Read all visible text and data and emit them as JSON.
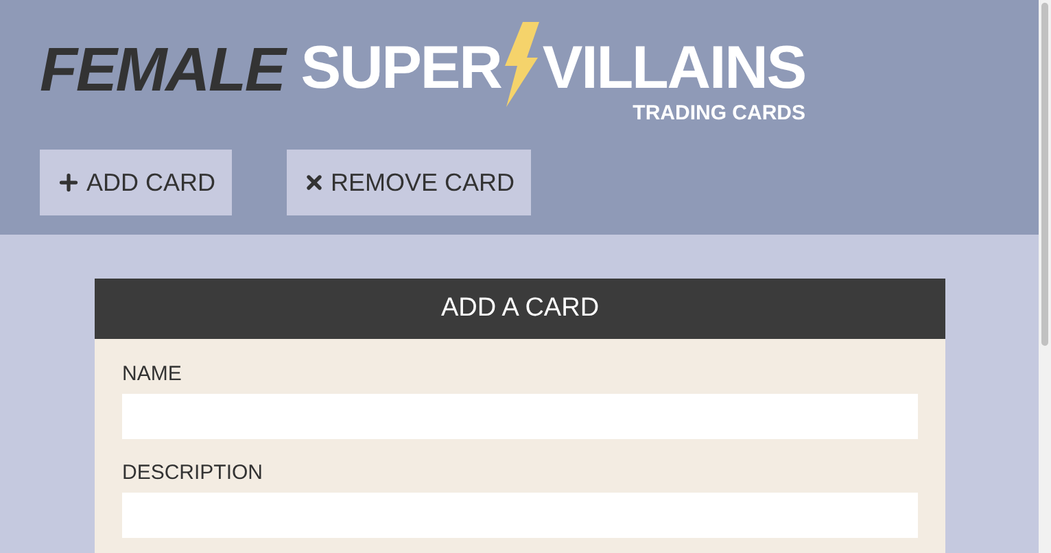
{
  "logo": {
    "word_1": "FEMALE",
    "word_2": "SUPER",
    "word_3": "VILLAINS",
    "tagline": "TRADING CARDS"
  },
  "toolbar": [
    {
      "kind": "add",
      "label": "ADD CARD"
    },
    {
      "kind": "remove",
      "label": "REMOVE CARD"
    }
  ],
  "form": {
    "title": "ADD A CARD",
    "fields": [
      {
        "label": "NAME"
      },
      {
        "label": "DESCRIPTION"
      }
    ]
  }
}
